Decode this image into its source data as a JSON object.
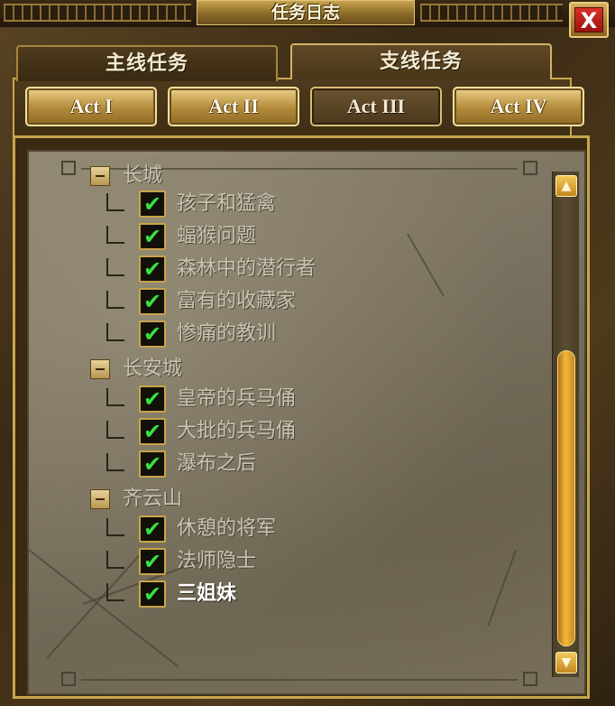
{
  "window": {
    "title": "任务日志",
    "close_label": "X"
  },
  "tabs": [
    {
      "label": "主线任务",
      "active": false
    },
    {
      "label": "支线任务",
      "active": true
    }
  ],
  "acts": [
    {
      "label": "Act I",
      "active": false
    },
    {
      "label": "Act II",
      "active": false
    },
    {
      "label": "Act III",
      "active": true
    },
    {
      "label": "Act IV",
      "active": false
    }
  ],
  "quest_log": {
    "groups": [
      {
        "label": "长城",
        "quests": [
          {
            "label": "孩子和猛禽",
            "done": true
          },
          {
            "label": "蝠猴问题",
            "done": true
          },
          {
            "label": "森林中的潜行者",
            "done": true
          },
          {
            "label": "富有的收藏家",
            "done": true
          },
          {
            "label": "惨痛的教训",
            "done": true
          }
        ]
      },
      {
        "label": "长安城",
        "quests": [
          {
            "label": "皇帝的兵马俑",
            "done": true
          },
          {
            "label": "大批的兵马俑",
            "done": true
          },
          {
            "label": "瀑布之后",
            "done": true
          }
        ]
      },
      {
        "label": "齐云山",
        "quests": [
          {
            "label": "休憩的将军",
            "done": true
          },
          {
            "label": "法师隐士",
            "done": true
          },
          {
            "label": "三姐妹",
            "done": true,
            "current": true
          }
        ]
      }
    ],
    "check_glyph": "✔"
  },
  "scrollbar": {
    "up_glyph": "▲",
    "down_glyph": "▼",
    "position": 0.62
  },
  "colors": {
    "accent_gold": "#c8a64e",
    "check_green": "#3ae040",
    "text_grey": "#c8c4b4",
    "close_red": "#d8322a"
  }
}
